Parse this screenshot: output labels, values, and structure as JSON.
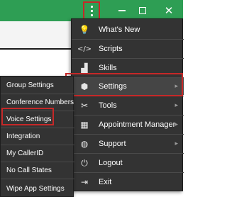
{
  "titlebar": {
    "menu_icon": "more-vertical-icon",
    "minimize_glyph": "",
    "maximize_glyph": "",
    "close_glyph": "✕",
    "bar_color": "#2e9e54"
  },
  "main_menu": {
    "items": [
      {
        "label": "What's New",
        "icon": "lightbulb-icon",
        "icon_glyph": "💡"
      },
      {
        "label": "Scripts",
        "icon": "code-icon",
        "icon_glyph": "</>"
      },
      {
        "label": "Skills",
        "icon": "stairs-icon",
        "icon_glyph": "▟"
      },
      {
        "label": "Settings",
        "icon": "package-icon",
        "icon_glyph": "⬢",
        "arrow": "▸",
        "highlighted": true
      },
      {
        "label": "Tools",
        "icon": "tools-icon",
        "icon_glyph": "✂",
        "arrow": "▸"
      },
      {
        "label": "Appointment Manager",
        "icon": "calendar-icon",
        "icon_glyph": "▦",
        "arrow": "▸"
      },
      {
        "label": "Support",
        "icon": "globe-icon",
        "icon_glyph": "◍",
        "arrow": "▸"
      },
      {
        "label": "Logout",
        "icon": "power-icon",
        "icon_glyph": "⏻"
      },
      {
        "label": "Exit",
        "icon": "exit-icon",
        "icon_glyph": "⇥"
      }
    ]
  },
  "settings_submenu": {
    "items": [
      {
        "label": "Group Settings"
      },
      {
        "label": "Conference Numbers"
      },
      {
        "label": "Voice Settings",
        "highlighted": true
      },
      {
        "label": "Integration"
      },
      {
        "label": "My CallerID"
      },
      {
        "label": "No Call States"
      },
      {
        "label": "Wipe App Settings"
      }
    ]
  },
  "colors": {
    "menu_bg": "#333333",
    "highlight_frame": "#c62828",
    "menu_text": "#ffffff"
  }
}
